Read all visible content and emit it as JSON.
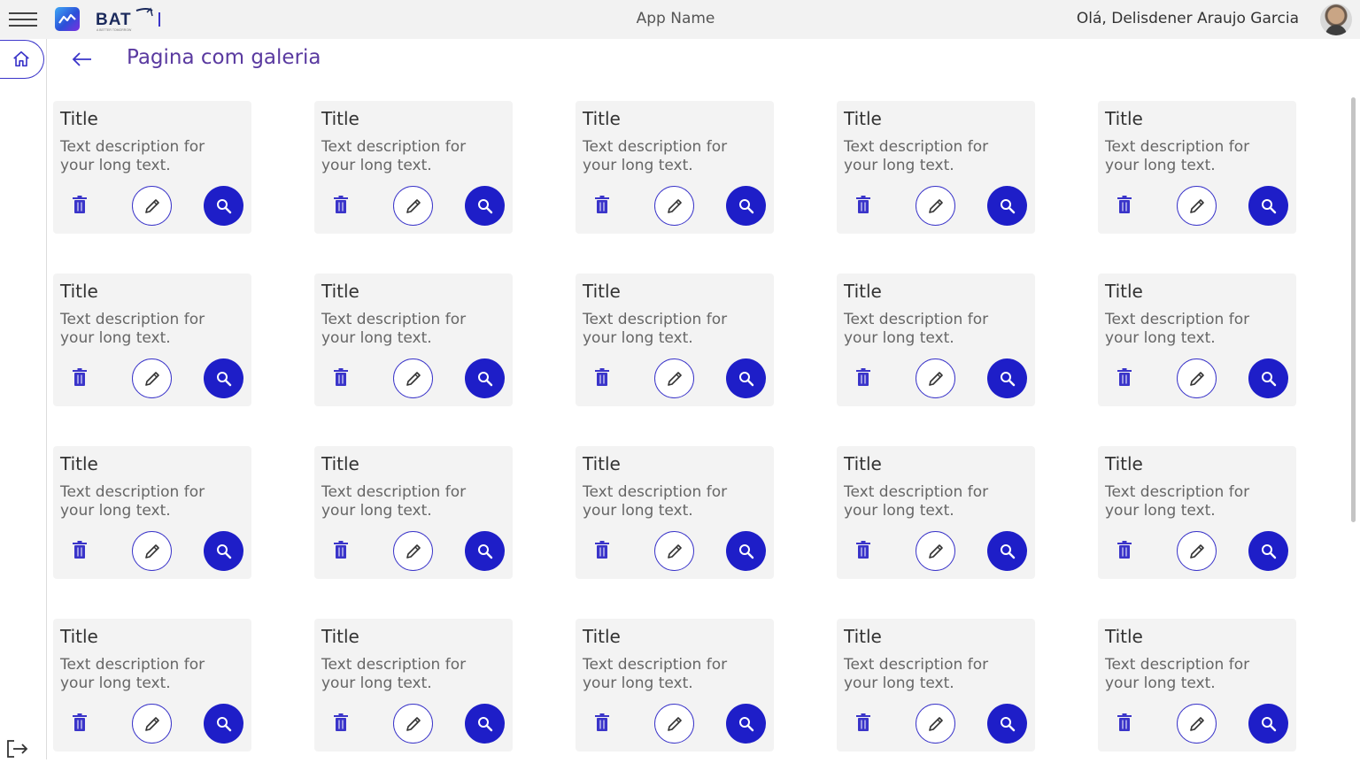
{
  "header": {
    "app_name": "App Name",
    "greeting": "Olá, Delisdener Araujo Garcia",
    "brand_text": "BAT",
    "brand_tagline": "A BETTER TOMORROW"
  },
  "page": {
    "title": "Pagina com galeria"
  },
  "colors": {
    "accent": "#1e1ec8",
    "title": "#5a3aa0",
    "card_bg": "#f3f3f3"
  },
  "gallery": {
    "cards": [
      {
        "title": "Title",
        "description": "Text description for your long text."
      },
      {
        "title": "Title",
        "description": "Text description for your long text."
      },
      {
        "title": "Title",
        "description": "Text description for your long text."
      },
      {
        "title": "Title",
        "description": "Text description for your long text."
      },
      {
        "title": "Title",
        "description": "Text description for your long text."
      },
      {
        "title": "Title",
        "description": "Text description for your long text."
      },
      {
        "title": "Title",
        "description": "Text description for your long text."
      },
      {
        "title": "Title",
        "description": "Text description for your long text."
      },
      {
        "title": "Title",
        "description": "Text description for your long text."
      },
      {
        "title": "Title",
        "description": "Text description for your long text."
      },
      {
        "title": "Title",
        "description": "Text description for your long text."
      },
      {
        "title": "Title",
        "description": "Text description for your long text."
      },
      {
        "title": "Title",
        "description": "Text description for your long text."
      },
      {
        "title": "Title",
        "description": "Text description for your long text."
      },
      {
        "title": "Title",
        "description": "Text description for your long text."
      },
      {
        "title": "Title",
        "description": "Text description for your long text."
      },
      {
        "title": "Title",
        "description": "Text description for your long text."
      },
      {
        "title": "Title",
        "description": "Text description for your long text."
      },
      {
        "title": "Title",
        "description": "Text description for your long text."
      },
      {
        "title": "Title",
        "description": "Text description for your long text."
      }
    ],
    "card_icons": [
      "trash-icon",
      "pencil-icon",
      "magnifier-icon"
    ]
  }
}
